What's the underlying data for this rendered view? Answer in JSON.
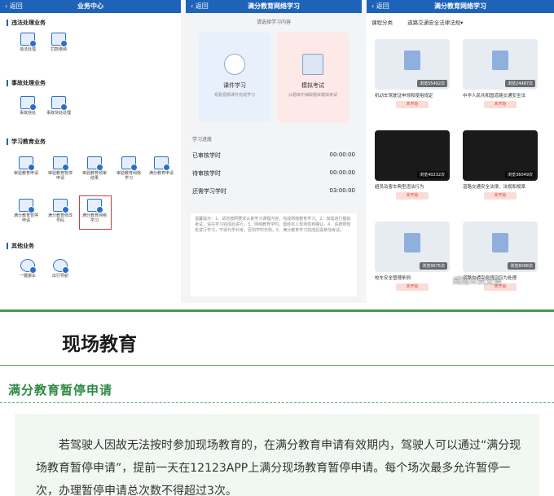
{
  "screen1": {
    "back": "返回",
    "title": "业务中心",
    "sections": [
      {
        "title": "违法处理业务",
        "items": [
          "违法处理",
          "罚款缴纳"
        ]
      },
      {
        "title": "事故处理业务",
        "items": [
          "事故快处",
          "事故快处处理"
        ]
      },
      {
        "title": "学习教育业务",
        "items": [
          "审验教育申请",
          "审验教育暂停申请",
          "审验教育预审结果",
          "审验教育网络学习",
          "满分教育申请",
          "满分教育暂停申请",
          "满分教育修改号码",
          "满分教育网络学习"
        ]
      },
      {
        "title": "其他业务",
        "items": [
          "一键挪车",
          "出行导航"
        ]
      }
    ]
  },
  "screen2": {
    "back": "返回",
    "title": "满分教育网络学习",
    "hint": "请选择学习内容",
    "card1": {
      "title": "课件学习",
      "sub": "观看视频课件完成学习"
    },
    "card2": {
      "title": "模拟考试",
      "sub": "从题库中抽取题目模拟考试"
    },
    "record_title": "学习进度",
    "records": [
      {
        "label": "已审核学时",
        "value": "00:00:00"
      },
      {
        "label": "待审核学时",
        "value": "00:00:00"
      },
      {
        "label": "还需学习学时",
        "value": "03:00:00"
      }
    ],
    "tips": "温馨提示：1、请您按照要求认真学习课程内容，完成网络教育学习。2、如需进行模拟考试，请在学习完成后进行。3、网络教育学时，需经本人现场签到确认。4、请按照规定进行学习，不得代学代考，否则学时无效。5、满分教育学习完成后需参加考试。"
  },
  "screen3": {
    "back": "返回",
    "title": "满分教育网络学习",
    "category": "课程分类",
    "selected": "道路交通安全法律法规▾",
    "videos": [
      {
        "count": "浏览55492次",
        "title": "机动车驾驶证申领和使用规定",
        "btn": "未开始"
      },
      {
        "count": "浏览24487次",
        "title": "中华人民共和国道路交通安全法",
        "btn": "未开始"
      },
      {
        "count": "浏览40232次",
        "title": "超员及客车典型违法行为",
        "btn": "未开始"
      },
      {
        "count": "浏览36049次",
        "title": "道路交通安全法律、法规和规章",
        "btn": "未开始"
      },
      {
        "count": "浏览9675次",
        "title": "校车安全管理条例",
        "btn": "未开始"
      },
      {
        "count": "浏览8098次",
        "title": "道路交通安全违法行为处理",
        "btn": "未开始"
      }
    ],
    "watermark": "威远公安交警"
  },
  "article": {
    "heading": "现场教育",
    "subhead": "满分教育暂停申请",
    "paragraph": "若驾驶人因故无法按时参加现场教育的，在满分教育申请有效期内，驾驶人可以通过“满分现场教育暂停申请”，提前一天在12123APP上满分现场教育暂停申请。每个场次最多允许暂停一次，办理暂停申请总次数不得超过3次。"
  },
  "colors": {
    "brand_blue": "#1e63b8",
    "accent_green": "#2e8a43",
    "highlight_red": "#d23a3a"
  }
}
